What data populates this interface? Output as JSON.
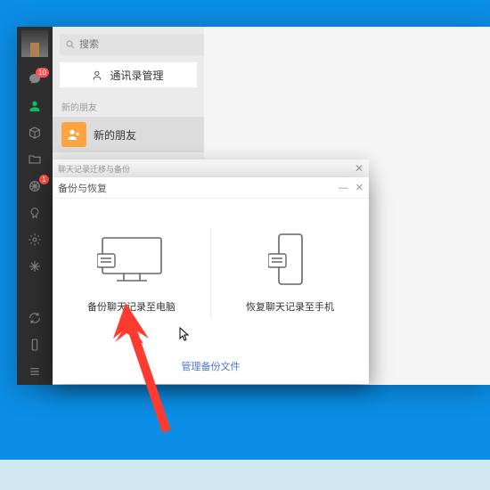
{
  "sidebar": {
    "chat_badge": "10",
    "moments_badge": "1"
  },
  "contacts": {
    "search_placeholder": "搜索",
    "manage_label": "通讯录管理",
    "section_label": "新的朋友",
    "new_friend_label": "新的朋友"
  },
  "dialog_back": {
    "title": "聊天记录迁移与备份"
  },
  "dialog": {
    "title": "备份与恢复",
    "backup_to_pc_label": "备份聊天记录至电脑",
    "restore_to_phone_label": "恢复聊天记录至手机",
    "manage_files_label": "管理备份文件"
  }
}
